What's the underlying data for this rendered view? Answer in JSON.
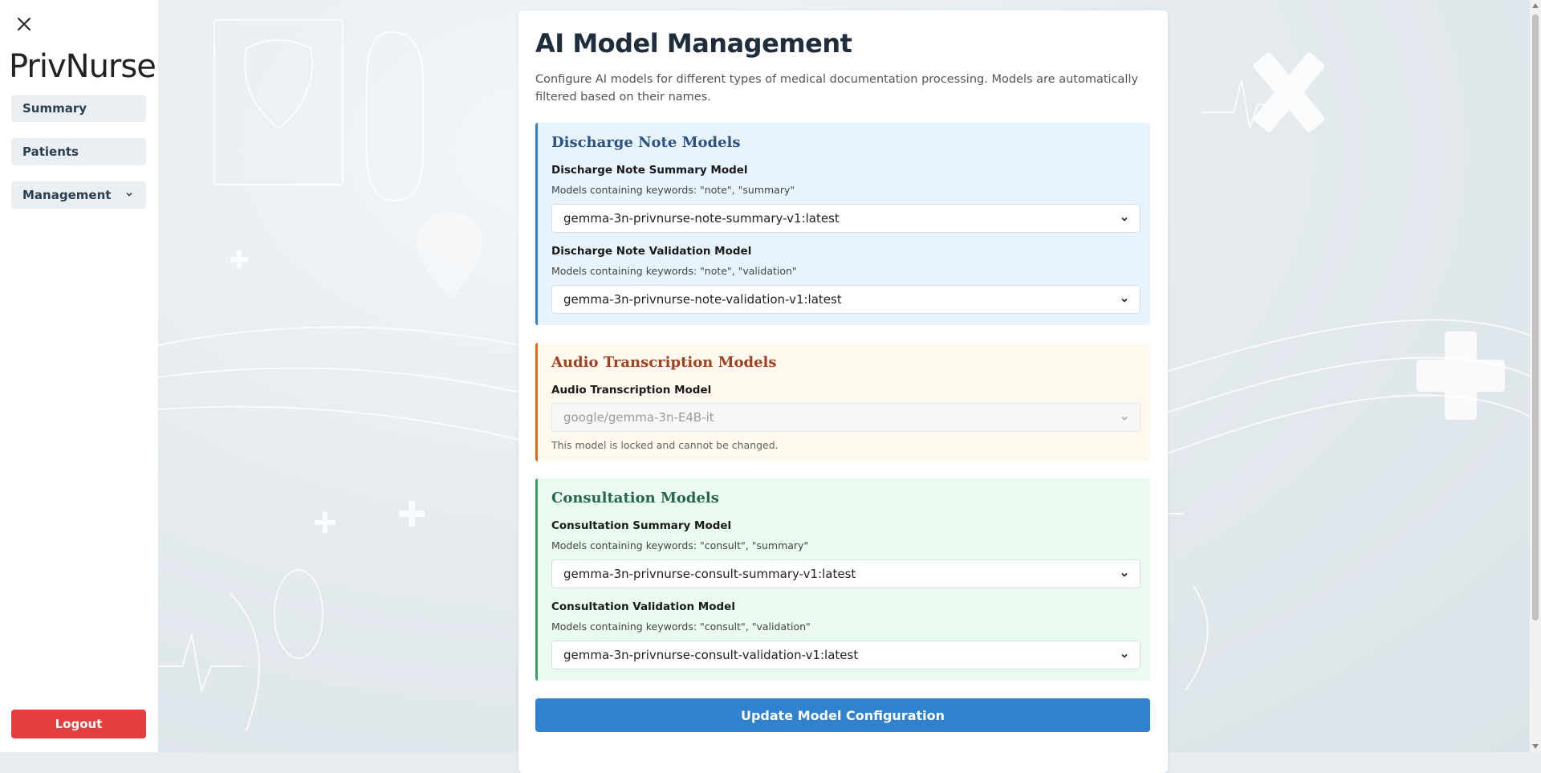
{
  "sidebar": {
    "logo": "PrivNurse",
    "items": [
      {
        "label": "Summary"
      },
      {
        "label": "Patients"
      },
      {
        "label": "Management"
      }
    ],
    "logout_label": "Logout"
  },
  "main": {
    "title": "AI Model Management",
    "description": "Configure AI models for different types of medical documentation processing. Models are automatically filtered based on their names.",
    "sections": [
      {
        "title": "Discharge Note Models",
        "color": "#2c5282",
        "fields": [
          {
            "label": "Discharge Note Summary Model",
            "hint": "Models containing keywords: \"note\", \"summary\"",
            "value": "gemma-3n-privnurse-note-summary-v1:latest"
          },
          {
            "label": "Discharge Note Validation Model",
            "hint": "Models containing keywords: \"note\", \"validation\"",
            "value": "gemma-3n-privnurse-note-validation-v1:latest"
          }
        ]
      },
      {
        "title": "Audio Transcription Models",
        "color": "#9c4221",
        "fields": [
          {
            "label": "Audio Transcription Model",
            "value": "google/gemma-3n-E4B-it",
            "note": "This model is locked and cannot be changed."
          }
        ]
      },
      {
        "title": "Consultation Models",
        "color": "#276749",
        "fields": [
          {
            "label": "Consultation Summary Model",
            "hint": "Models containing keywords: \"consult\", \"summary\"",
            "value": "gemma-3n-privnurse-consult-summary-v1:latest"
          },
          {
            "label": "Consultation Validation Model",
            "hint": "Models containing keywords: \"consult\", \"validation\"",
            "value": "gemma-3n-privnurse-consult-validation-v1:latest"
          }
        ]
      }
    ],
    "update_label": "Update Model Configuration"
  },
  "colors": {
    "logout": "#e53e3e",
    "primary_button": "#3182ce",
    "discharge_bg": "#e8f4fd",
    "discharge_border": "#3182ce",
    "audio_bg": "#fef8ee",
    "audio_border": "#dd6b20",
    "consult_bg": "#eafbf0",
    "consult_border": "#38a169"
  },
  "icons": {
    "close": "close-icon",
    "chevron": "chevron-down-icon"
  }
}
